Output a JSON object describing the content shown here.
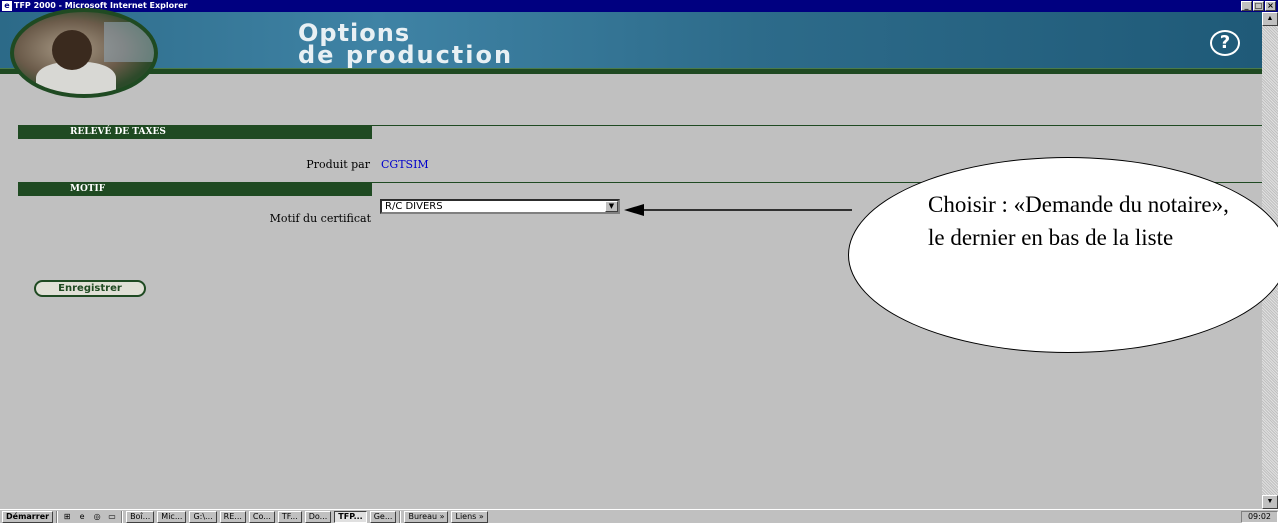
{
  "window": {
    "title": "TFP 2000 - Microsoft Internet Explorer",
    "ie_icon": "e",
    "controls": [
      "_",
      "□",
      "×"
    ]
  },
  "header": {
    "title_line1": "Options",
    "title_line2": "de production",
    "help_label": "?"
  },
  "section_releve": {
    "heading": "RELEVÉ DE TAXES",
    "produced_by_label": "Produit par",
    "produced_by_value": "CGTSIM"
  },
  "section_motif": {
    "heading": "MOTIF",
    "certificate_reason_label": "Motif du certificat",
    "certificate_reason_value": "R/C DIVERS",
    "dropdown_arrow": "▼"
  },
  "actions": {
    "save_label": "Enregistrer"
  },
  "callout": {
    "text": "Choisir : «Demande du notaire», le dernier en bas de la liste"
  },
  "scrollbar": {
    "up": "▲",
    "down": "▼"
  },
  "taskbar": {
    "start": "Démarrer",
    "quick_launch": [
      "⊞",
      "e",
      "◎",
      "▭"
    ],
    "items": [
      {
        "label": "Boî...",
        "active": false
      },
      {
        "label": "Mic...",
        "active": false
      },
      {
        "label": "G:\\...",
        "active": false
      },
      {
        "label": "RE...",
        "active": false
      },
      {
        "label": "Co...",
        "active": false
      },
      {
        "label": "TF...",
        "active": false
      },
      {
        "label": "Do...",
        "active": false
      },
      {
        "label": "TFP...",
        "active": true
      },
      {
        "label": "Ge...",
        "active": false
      }
    ],
    "bureau": "Bureau »",
    "liens": "Liens »",
    "clock": "09:02"
  },
  "colors": {
    "header_green": "#1f4a22",
    "link_blue": "#0000cc",
    "title_bar": "#000080"
  }
}
